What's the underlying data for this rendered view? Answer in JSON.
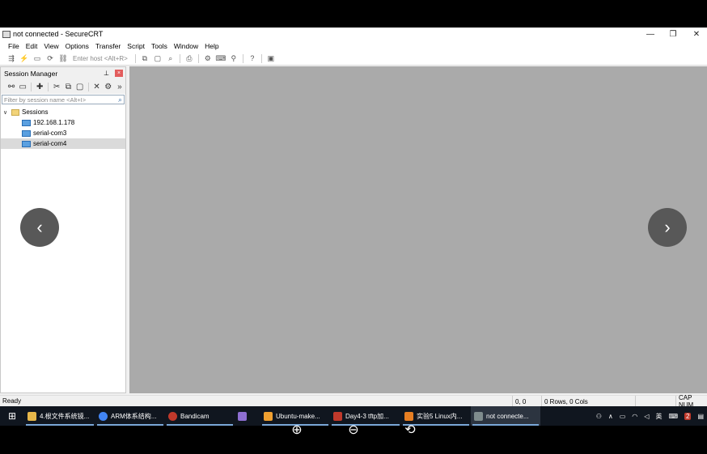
{
  "window": {
    "title": "not connected - SecureCRT",
    "minimize": "—",
    "restore": "❐",
    "close": "✕"
  },
  "menu": [
    "File",
    "Edit",
    "View",
    "Options",
    "Transfer",
    "Script",
    "Tools",
    "Window",
    "Help"
  ],
  "toolbar": {
    "host_placeholder": "Enter host <Alt+R>"
  },
  "session_manager": {
    "title": "Session Manager",
    "pin": "⊥",
    "close": "×",
    "filter_placeholder": "Filter by session name <Alt+I>",
    "tree": {
      "root": "Sessions",
      "items": [
        "192.168.1.178",
        "serial-com3",
        "serial-com4"
      ],
      "selected_index": 2
    }
  },
  "status": {
    "ready": "Ready",
    "position": "0, 0",
    "size": "0 Rows, 0 Cols",
    "caps": "CAP NUM"
  },
  "taskbar": {
    "items": [
      {
        "label": "4.根文件系统镜...",
        "color": "#e8b84a"
      },
      {
        "label": "ARM体系结构...",
        "color": "#4285f4"
      },
      {
        "label": "Bandicam",
        "color": "#c0392b"
      },
      {
        "label": "",
        "color": "#8e6fd1"
      },
      {
        "label": "Ubuntu-make...",
        "color": "#f0a030"
      },
      {
        "label": "Day4-3 tftp加...",
        "color": "#c0392b"
      },
      {
        "label": "实验5 Linux内...",
        "color": "#e67e22"
      },
      {
        "label": "not connecte...",
        "color": "#7f8c8d"
      }
    ],
    "tray": {
      "ime": "英",
      "notifications": "2"
    }
  },
  "viewer": {
    "prev": "‹",
    "next": "›",
    "zoom_in": "⊕",
    "zoom_out": "⊖",
    "rotate": "⟲"
  }
}
